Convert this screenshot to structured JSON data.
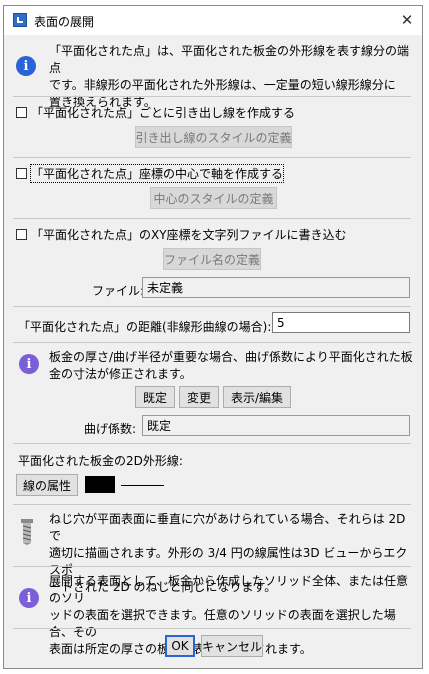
{
  "window": {
    "title": "表面の展開",
    "close_glyph": "✕"
  },
  "info1": {
    "line1": "「平面化された点」は、平面化された板金の外形線を表す線分の端点",
    "line2": "です。非線形の平面化された外形線は、一定量の短い線形線分に",
    "line3": "置き換えられます。"
  },
  "option1": {
    "label": "「平面化された点」ごとに引き出し線を作成する",
    "button": "引き出し線のスタイルの定義",
    "checked": false
  },
  "option2": {
    "label": "「平面化された点」座標の中心で軸を作成する",
    "button": "中心のスタイルの定義",
    "checked": false
  },
  "option3": {
    "label": "「平面化された点」のXY座標を文字列ファイルに書き込む",
    "button": "ファイル名の定義",
    "file_label": "ファイル:",
    "file_value": "未定義",
    "checked": false
  },
  "distance": {
    "label": "「平面化された点」の距離(非線形曲線の場合):",
    "value": "5"
  },
  "info2": {
    "line1": "板金の厚さ/曲げ半径が重要な場合、曲げ係数により平面化された板",
    "line2": "金の寸法が修正されます。"
  },
  "bend": {
    "default_button": "既定",
    "change_button": "変更",
    "show_edit_button": "表示/編集",
    "factor_label": "曲げ係数:",
    "factor_value": "既定"
  },
  "outline": {
    "heading": "平面化された板金の2D外形線:",
    "attr_button": "線の属性",
    "color": "#000000"
  },
  "info3": {
    "line1": "ねじ穴が平面表面に垂直に穴があけられている場合、それらは 2D で",
    "line2": "適切に描画されます。外形の 3/4 円の線属性は3D ビューからエクスポ",
    "line3": "ートされた 2D のねじと同じになります。"
  },
  "info4": {
    "line1": "展開する表面として、板金から作成したソリッド全体、または任意のソリ",
    "line2": "ッドの表面を選択できます。任意のソリッドの表面を選択した場合、その",
    "line3": "表面は所定の厚さの板金の表面とみなされます。"
  },
  "footer": {
    "ok": "OK",
    "cancel": "キャンセル"
  }
}
